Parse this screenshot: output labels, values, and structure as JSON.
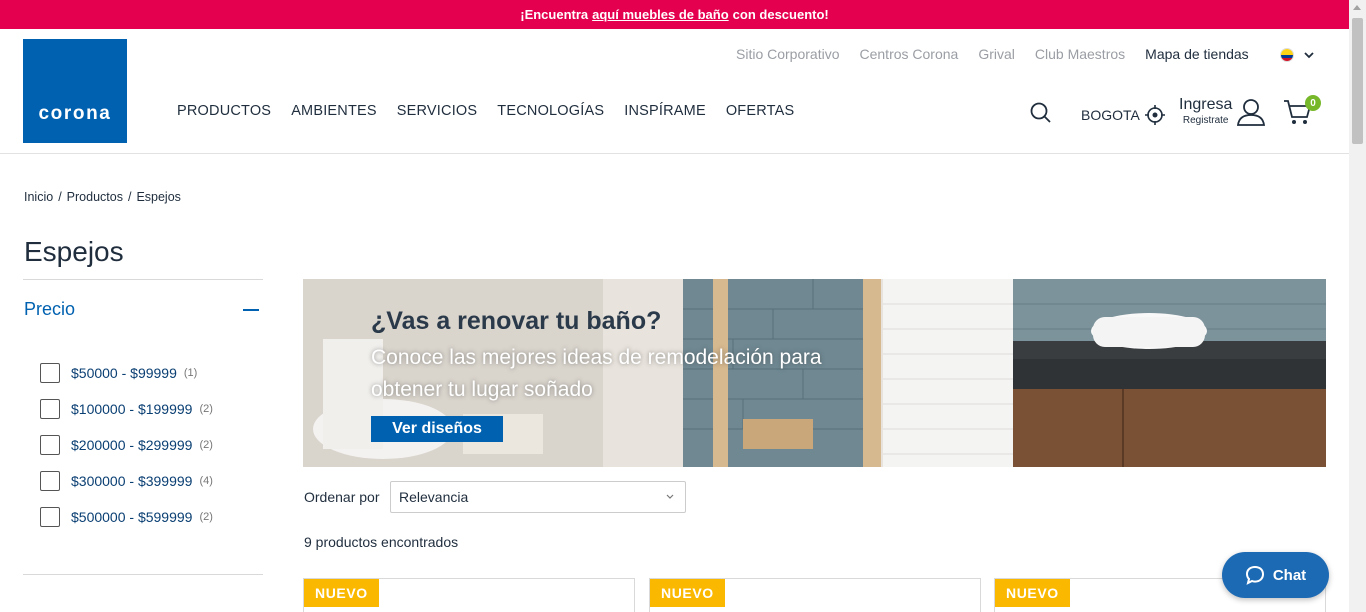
{
  "promo": {
    "before": "¡Encuentra",
    "link": "aquí muebles de baño",
    "after": "con descuento!"
  },
  "brand": {
    "logo_text": "corona",
    "color": "#0061b0"
  },
  "top_links": [
    "Sitio Corporativo",
    "Centros Corona",
    "Grival",
    "Club Maestros",
    "Mapa de tiendas"
  ],
  "main_nav": [
    "PRODUCTOS",
    "AMBIENTES",
    "SERVICIOS",
    "TECNOLOGÍAS",
    "INSPÍRAME",
    "OFERTAS"
  ],
  "header_tools": {
    "city": "BOGOTA",
    "login_main": "Ingresa",
    "login_sub": "Registrate",
    "cart_count": "0"
  },
  "breadcrumb": [
    "Inicio",
    "Productos",
    "Espejos"
  ],
  "page_title": "Espejos",
  "filter": {
    "title": "Precio",
    "options": [
      {
        "label": "$50000 - $99999",
        "count": "(1)"
      },
      {
        "label": "$100000 - $199999",
        "count": "(2)"
      },
      {
        "label": "$200000 - $299999",
        "count": "(2)"
      },
      {
        "label": "$300000 - $399999",
        "count": "(4)"
      },
      {
        "label": "$500000 - $599999",
        "count": "(2)"
      }
    ]
  },
  "banner": {
    "title": "¿Vas a renovar tu baño?",
    "subtitle": "Conoce las mejores ideas de remodelación para obtener tu lugar soñado",
    "button": "Ver diseños"
  },
  "sort": {
    "label": "Ordenar por",
    "selected": "Relevancia"
  },
  "results_count": "9 productos encontrados",
  "product_badges": [
    "NUEVO",
    "NUEVO",
    "NUEVO"
  ],
  "chat": {
    "label": "Chat"
  },
  "colors": {
    "promo": "#e4004e",
    "accent_green": "#76b82a",
    "badge": "#fbb800",
    "chat": "#1d6ab4"
  }
}
